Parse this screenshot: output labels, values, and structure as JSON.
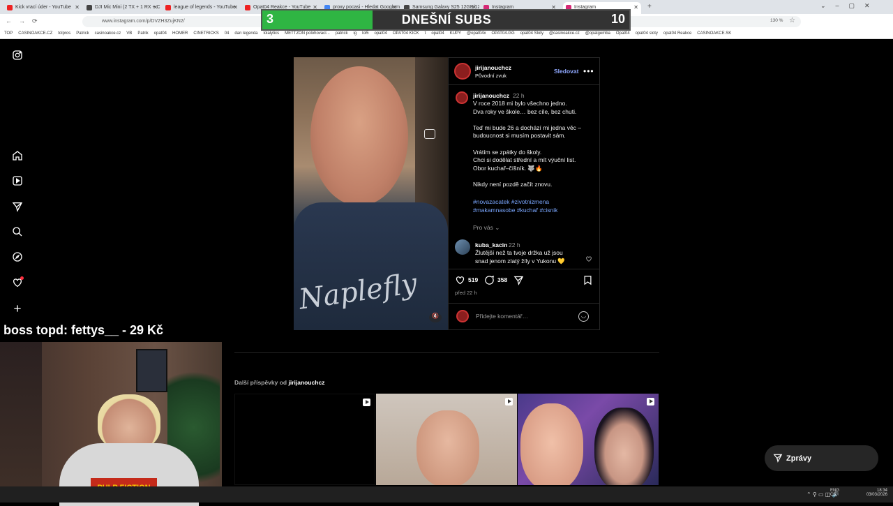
{
  "browser": {
    "tabs": [
      {
        "title": "Kick vrací úder - YouTube",
        "color": "#e22"
      },
      {
        "title": "DJI Mic Mini (2 TX + 1 RX + Ch",
        "color": "#444"
      },
      {
        "title": "league of legends - YouTube",
        "color": "#e22"
      },
      {
        "title": "Opat04 Reakce - YouTube",
        "color": "#e22"
      },
      {
        "title": "proxy pocasi - Hledat Googlem",
        "color": "#4285f4"
      },
      {
        "title": "Samsung Galaxy S25 12GB/128",
        "color": "#444"
      },
      {
        "title": "Instagram",
        "color": "#d62976"
      },
      {
        "title": "Instagram",
        "color": "#d62976"
      }
    ],
    "url": "www.instagram.com/p/DVZH3ZujKN2/",
    "zoom": "130 %",
    "bookmarks": [
      "TOP",
      "CASINOAKCE.CZ",
      "tolpros",
      "Patrick",
      "casinoakce.cz",
      "VB",
      "Patrik",
      "opat04",
      "HOMER",
      "CINETRICKS",
      "04",
      "dan legenda",
      "lolalytics",
      "METTZON polohovací...",
      "patrick",
      "ig",
      "lol5",
      "opat04",
      "OPAT04 KICK",
      "t",
      "opat04",
      "KUPY",
      "@opat04x",
      "OPAT04.GG",
      "opat04 Sloty",
      "@casinoakce.cz",
      "@opatgemba",
      "Opat04",
      "opat04 sloty",
      "opat04 Reakce",
      "CASINOAKCE.SK"
    ]
  },
  "subs_overlay": {
    "current": "3",
    "title": "DNEŠNÍ SUBS",
    "goal": "10",
    "progress": 0.3
  },
  "sidebar": {
    "icons": [
      "instagram-icon",
      "home-icon",
      "reels-icon",
      "send-icon",
      "search-icon",
      "explore-icon",
      "heart-icon",
      "plus-icon"
    ]
  },
  "post": {
    "username": "jirijanouchcz",
    "audio": "Původní zvuk",
    "follow": "Sledovat",
    "caption_user": "jirijanouchcz",
    "caption_time": "22 h",
    "caption_lines": [
      "V roce 2018 mi bylo všechno jedno.",
      "Dva roky ve škole… bez cíle, bez chuti.",
      "",
      "Teď mi bude 26 a dochází mi jedna věc –",
      "budoucnost si musím postavit sám.",
      "",
      "Vrátím se zpátky do školy.",
      "Chci si dodělat střední a mít výuční list.",
      "Obor kuchař–číšník. 🐺🔥",
      "",
      "Nikdy není pozdě začít znovu."
    ],
    "hashtags_line1": "#novazacatek #zivotnizmena",
    "hashtags_line2": "#makamnasobe #kuchař #cisnik",
    "for_you": "Pro vás",
    "comment_user": "kuba_kacin",
    "comment_time": "22 h",
    "comment_line1": "Žlutější než ta tvoje držka už jsou",
    "comment_line2": "snad jenom zlatý žíly v Yukonu 💛",
    "likes": "519",
    "comments": "358",
    "posted": "před 22 h",
    "comment_placeholder": "Přidejte komentář…",
    "video_overlay_text": "Naplefly"
  },
  "more_posts": {
    "label": "Další příspěvky od",
    "user": "jirijanouchcz"
  },
  "messages": "Zprávy",
  "stream": {
    "donation": "boss topd:  fettys__ - 29 Kč"
  },
  "taskbar": {
    "lang": "ENG",
    "lang2": "CS",
    "time": "18:34",
    "date": "03/03/2026"
  }
}
